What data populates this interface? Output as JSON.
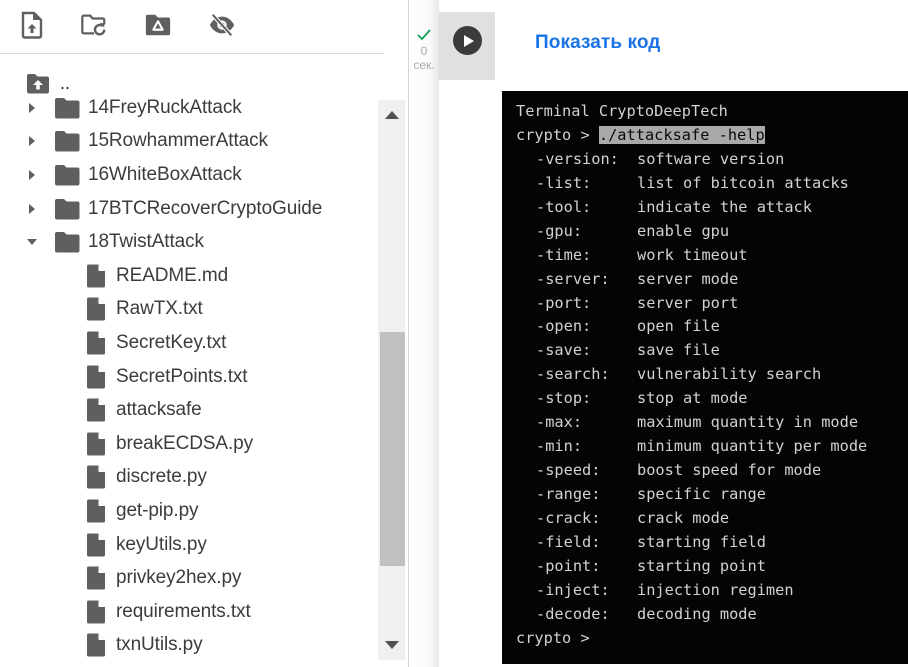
{
  "toolbar": {
    "buttons": [
      {
        "name": "upload-file",
        "icon": "file-upload-icon",
        "label": "Upload file"
      },
      {
        "name": "refresh",
        "icon": "folder-refresh-icon",
        "label": "Refresh"
      },
      {
        "name": "mount-drive",
        "icon": "google-drive-folder-icon",
        "label": "Mount Drive"
      },
      {
        "name": "toggle-hidden",
        "icon": "eye-off-icon",
        "label": "Show hidden files"
      }
    ]
  },
  "file_tree": {
    "parent_label": "..",
    "items": [
      {
        "type": "folder",
        "name": "14FreyRuckAttack",
        "expanded": false
      },
      {
        "type": "folder",
        "name": "15RowhammerAttack",
        "expanded": false
      },
      {
        "type": "folder",
        "name": "16WhiteBoxAttack",
        "expanded": false
      },
      {
        "type": "folder",
        "name": "17BTCRecoverCryptoGuide",
        "expanded": false
      },
      {
        "type": "folder",
        "name": "18TwistAttack",
        "expanded": true
      },
      {
        "type": "file",
        "name": "README.md"
      },
      {
        "type": "file",
        "name": "RawTX.txt"
      },
      {
        "type": "file",
        "name": "SecretKey.txt"
      },
      {
        "type": "file",
        "name": "SecretPoints.txt"
      },
      {
        "type": "file",
        "name": "attacksafe"
      },
      {
        "type": "file",
        "name": "breakECDSA.py"
      },
      {
        "type": "file",
        "name": "discrete.py"
      },
      {
        "type": "file",
        "name": "get-pip.py"
      },
      {
        "type": "file",
        "name": "keyUtils.py"
      },
      {
        "type": "file",
        "name": "privkey2hex.py"
      },
      {
        "type": "file",
        "name": "requirements.txt"
      },
      {
        "type": "file",
        "name": "txnUtils.py"
      }
    ],
    "scroll_position_fraction": 0.6
  },
  "cell": {
    "status_icon": "check-icon",
    "status_color": "#0f9d58",
    "exec_time_value": "0",
    "exec_time_unit": "сек.",
    "run_icon": "play-icon",
    "show_code_label": "Показать код",
    "link_color": "#1a73e8"
  },
  "terminal": {
    "title": "Terminal CryptoDeepTech",
    "prompt": "crypto > ",
    "command": "./attacksafe -help",
    "options": [
      {
        "flag": "-version:",
        "desc": "software version"
      },
      {
        "flag": "-list:",
        "desc": "list of bitcoin attacks"
      },
      {
        "flag": "-tool:",
        "desc": "indicate the attack"
      },
      {
        "flag": "-gpu:",
        "desc": "enable gpu"
      },
      {
        "flag": "-time:",
        "desc": "work timeout"
      },
      {
        "flag": "-server:",
        "desc": "server mode"
      },
      {
        "flag": "-port:",
        "desc": "server port"
      },
      {
        "flag": "-open:",
        "desc": "open file"
      },
      {
        "flag": "-save:",
        "desc": "save file"
      },
      {
        "flag": "-search:",
        "desc": "vulnerability search"
      },
      {
        "flag": "-stop:",
        "desc": "stop at mode"
      },
      {
        "flag": "-max:",
        "desc": "maximum quantity in mode"
      },
      {
        "flag": "-min:",
        "desc": "minimum quantity per mode"
      },
      {
        "flag": "-speed:",
        "desc": "boost speed for mode"
      },
      {
        "flag": "-range:",
        "desc": "specific range"
      },
      {
        "flag": "-crack:",
        "desc": "crack mode"
      },
      {
        "flag": "-field:",
        "desc": "starting field"
      },
      {
        "flag": "-point:",
        "desc": "starting point"
      },
      {
        "flag": "-inject:",
        "desc": "injection regimen"
      },
      {
        "flag": "-decode:",
        "desc": "decoding mode"
      }
    ],
    "final_prompt": "crypto >"
  }
}
